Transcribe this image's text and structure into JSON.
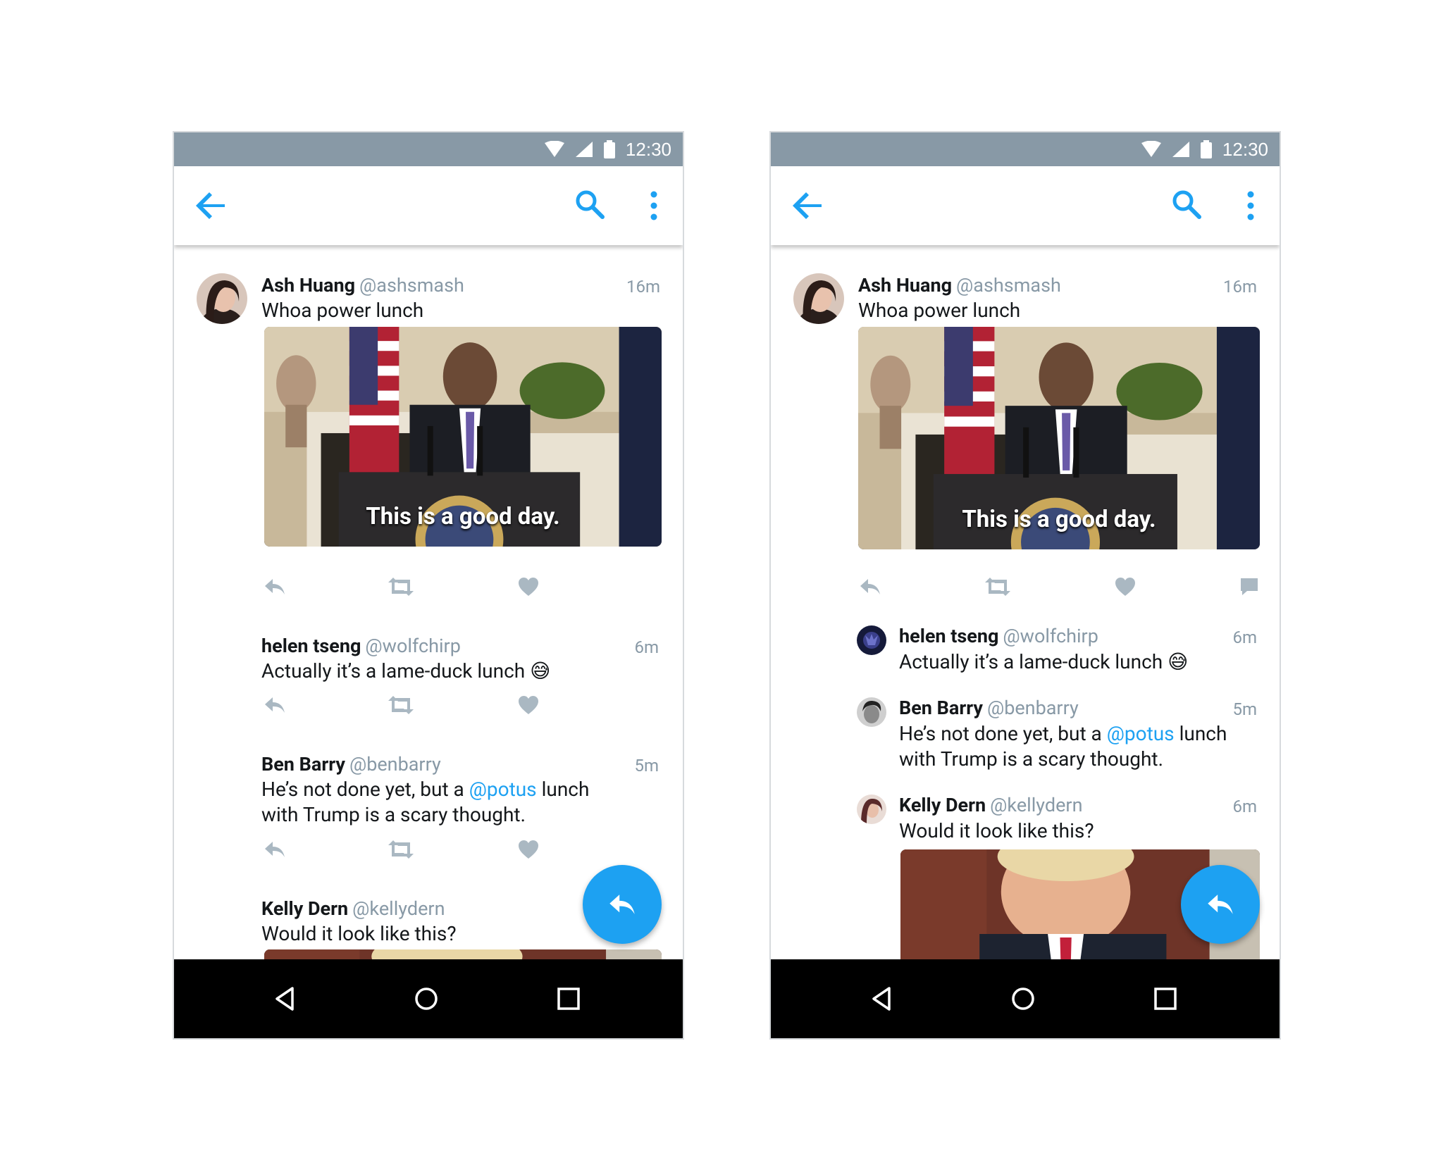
{
  "status": {
    "time": "12:30"
  },
  "tweets": {
    "t1": {
      "name": "Ash Huang",
      "handle": "@ashsmash",
      "time": "16m",
      "text": "Whoa power lunch",
      "caption": "This is a good day."
    },
    "t2": {
      "name": "helen tseng",
      "handle": "@wolfchirp",
      "time": "6m",
      "text": "Actually it’s a lame-duck lunch",
      "emoji": "😅"
    },
    "t3": {
      "name": "Ben Barry",
      "handle": "@benbarry",
      "time": "5m",
      "text_a": "He’s not done yet, but a",
      "mention": "@potus",
      "text_b": "lunch",
      "text_c": "with Trump is a scary thought."
    },
    "t4": {
      "name": "Kelly Dern",
      "handle": "@kellydern",
      "time": "6m",
      "text": "Would it look like this?"
    }
  },
  "icons": {
    "back": "arrow-left-icon",
    "search": "search-icon",
    "more": "more-vertical-icon",
    "reply": "reply-icon",
    "retweet": "retweet-icon",
    "like": "heart-icon",
    "dm": "message-icon",
    "fab": "reply-icon"
  },
  "colors": {
    "accent": "#1da1f2",
    "statusbar": "#8899a6",
    "muted": "#8899a6",
    "action_gray": "#aab8c2"
  }
}
